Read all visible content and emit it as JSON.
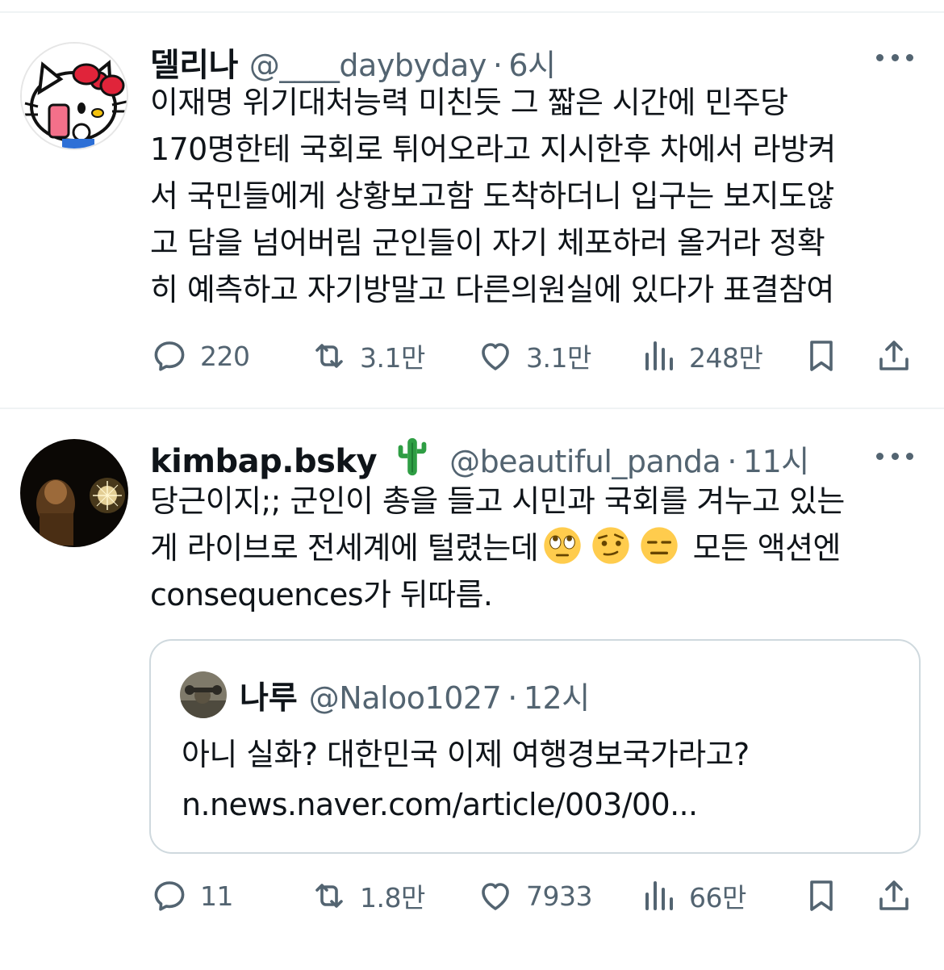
{
  "tweets": [
    {
      "author": {
        "name": "델리나",
        "handle": "@____daybyday",
        "time": "6시"
      },
      "text": "이재명 위기대처능력 미친듯 그 짧은 시간에 민주당\n170명한테 국회로 튀어오라고 지시한후 차에서 라방켜\n서 국민들에게 상황보고함 도착하더니 입구는 보지도않\n고 담을 넘어버림 군인들이 자기 체포하러 올거라 정확\n히 예측하고 자기방말고 다른의원실에 있다가 표결참여",
      "stats": {
        "replies": "220",
        "retweets": "3.1만",
        "likes": "3.1만",
        "views": "248만"
      }
    },
    {
      "author": {
        "name": "kimbap.bsky",
        "emoji": "🌵",
        "handle": "@beautiful_panda",
        "time": "11시"
      },
      "text_line1": "당근이지;; 군인이 총을 들고 시민과 국회를 겨누고 있는",
      "text_line2_start": "게 라이브로 전세계에 털렸는데",
      "emojis": [
        "🙄",
        "🤨",
        "😑"
      ],
      "text_line2_end": " 모든 액션엔",
      "text_line3": "consequences가 뒤따름.",
      "quote": {
        "name": "나루",
        "handle": "@Naloo1027",
        "time": "12시",
        "text": "아니 실화? 대한민국 이제 여행경보국가라고?\nn.news.naver.com/article/003/00..."
      },
      "stats": {
        "replies": "11",
        "retweets": "1.8만",
        "likes": "7933",
        "views": "66만"
      }
    }
  ],
  "separator_dot": "·",
  "colors": {
    "secondary": "#536471",
    "border": "#cfd9de",
    "divider": "#eff3f4",
    "cactus": "#2f9e44"
  },
  "icons": [
    "reply-icon",
    "retweet-icon",
    "like-icon",
    "views-icon",
    "bookmark-icon",
    "share-icon",
    "more-icon"
  ]
}
